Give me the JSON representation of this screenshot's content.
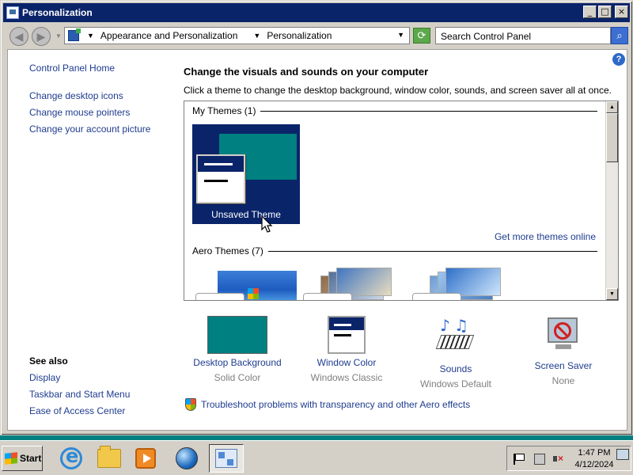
{
  "window": {
    "title": "Personalization",
    "btn_min": "_",
    "btn_max": "□",
    "btn_close": "×"
  },
  "address": {
    "segments": [
      "Appearance and Personalization",
      "Personalization"
    ],
    "search_placeholder": "Search Control Panel"
  },
  "left_nav": {
    "home": "Control Panel Home",
    "items": [
      "Change desktop icons",
      "Change mouse pointers",
      "Change your account picture"
    ],
    "see_also_title": "See also",
    "see_also": [
      "Display",
      "Taskbar and Start Menu",
      "Ease of Access Center"
    ]
  },
  "main": {
    "title": "Change the visuals and sounds on your computer",
    "subtitle": "Click a theme to change the desktop background, window color, sounds, and screen saver all at once.",
    "my_themes_header": "My Themes (1)",
    "selected_theme": "Unsaved Theme",
    "get_more": "Get more themes online",
    "aero_header": "Aero Themes (7)"
  },
  "settings": [
    {
      "label": "Desktop Background",
      "value": "Solid Color"
    },
    {
      "label": "Window Color",
      "value": "Windows Classic"
    },
    {
      "label": "Sounds",
      "value": "Windows Default"
    },
    {
      "label": "Screen Saver",
      "value": "None"
    }
  ],
  "troubleshoot": "Troubleshoot problems with transparency and other Aero effects",
  "taskbar": {
    "start": "Start",
    "time": "1:47 PM",
    "date": "4/12/2024"
  },
  "colors": {
    "title_bar": "#0a246a",
    "desktop": "#008080",
    "link": "#1f3c8f"
  }
}
